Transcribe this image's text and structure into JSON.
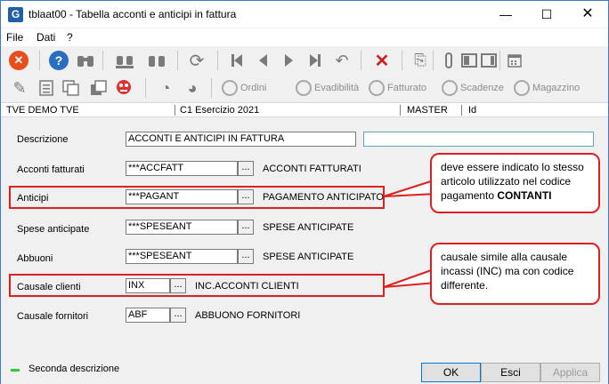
{
  "window": {
    "title": "tblaat00 - Tabella acconti e anticipi in fattura",
    "app_icon_letter": "G",
    "minimize": "—",
    "maximize": "☐",
    "close": "✕"
  },
  "menu": {
    "file": "File",
    "dati": "Dati",
    "help": "?"
  },
  "toolbar2": {
    "ordini": "Ordini",
    "evadibilita": "Evadibilità",
    "fatturato": "Fatturato",
    "scadenze": "Scadenze",
    "magazzino": "Magazzino"
  },
  "status_strip": {
    "company": "TVE DEMO TVE",
    "exercise": "C1 Esercizio 2021",
    "user": "MASTER",
    "id": "Id"
  },
  "form": {
    "descrizione_label": "Descrizione",
    "descrizione_value": "ACCONTI E ANTICIPI IN FATTURA",
    "descrizione_alt_value": "",
    "rows": [
      {
        "label": "Acconti fatturati",
        "code": "***ACCFATT",
        "desc": "ACCONTI FATTURATI"
      },
      {
        "label": "Anticipi",
        "code": "***PAGANT",
        "desc": "PAGAMENTO ANTICIPATO"
      },
      {
        "label": "Spese anticipate",
        "code": "***SPESEANT",
        "desc": "SPESE ANTICIPATE"
      },
      {
        "label": "Abbuoni",
        "code": "***SPESEANT",
        "desc": "SPESE ANTICIPATE"
      },
      {
        "label": "Causale clienti",
        "code": "INX",
        "desc": "INC.ACCONTI CLIENTI"
      },
      {
        "label": "Causale fornitori",
        "code": "ABF",
        "desc": "ABBUONO FORNITORI"
      }
    ],
    "lookup_label": "..."
  },
  "callouts": {
    "anticipi_line1": "deve essere indicato lo stesso",
    "anticipi_line2": "articolo utilizzato nel codice",
    "anticipi_line3_prefix": "pagamento ",
    "anticipi_line3_bold": "CONTANTI",
    "causale_line1": "causale simile alla causale",
    "causale_line2": "incassi (INC) ma con codice",
    "causale_line3": "differente."
  },
  "footer": {
    "legend": "Seconda descrizione",
    "legend_color": "#2fcc2f",
    "ok": "OK",
    "esci": "Esci",
    "applica": "Applica"
  },
  "colors": {
    "accent_red": "#e02020",
    "title_blue": "#1f5fa8"
  }
}
